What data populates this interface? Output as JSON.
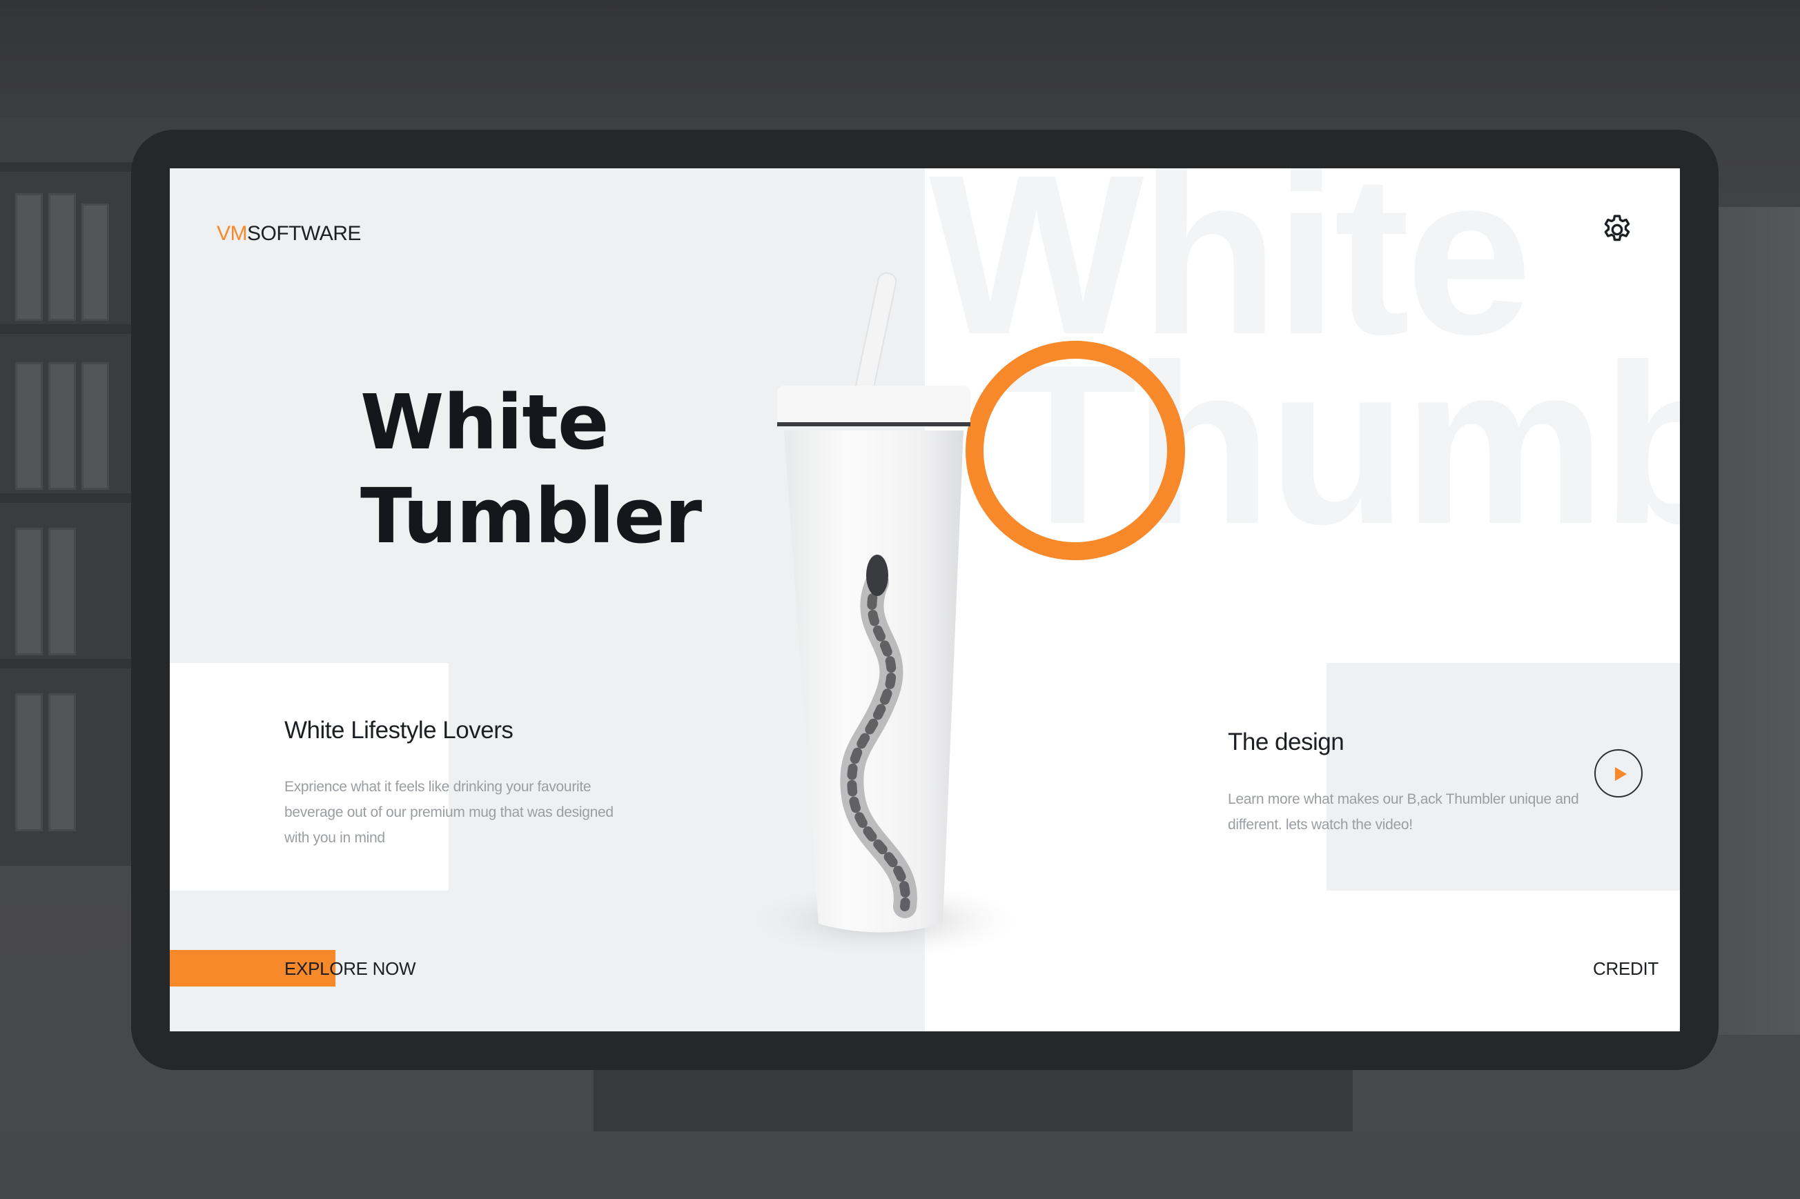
{
  "logo": {
    "accent": "VM",
    "rest": "SOFTWARE"
  },
  "hero": {
    "title_line1": "White",
    "title_line2": "Tumbler"
  },
  "background_words": {
    "line1": "White",
    "line2": "Thumble"
  },
  "lifestyle": {
    "title": "White Lifestyle Lovers",
    "text_line1": "Exprience what it feels like drinking your favourite",
    "text_line2": "beverage out of our premium mug that was designed",
    "text_line3": "with you in mind"
  },
  "design": {
    "title": "The design",
    "text_line1": "Learn more what makes our B,ack Thumbler unique and",
    "text_line2": "different. lets watch the video!"
  },
  "actions": {
    "explore": "EXPLORE NOW",
    "credit": "CREDIT"
  },
  "icons": {
    "settings": "gear-icon",
    "play": "play-icon"
  },
  "colors": {
    "accent": "#f7892b",
    "dark_text": "#1c1f24",
    "panel_gray": "#eff0f1"
  }
}
